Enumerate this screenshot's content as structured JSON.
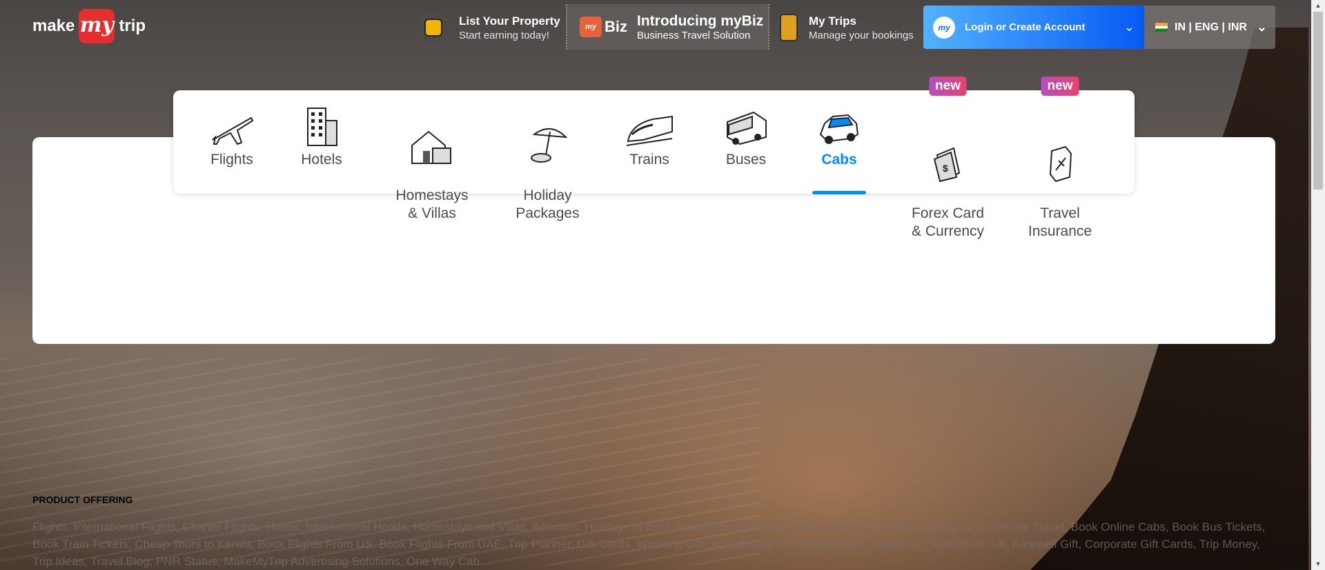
{
  "header": {
    "logo": {
      "make": "make",
      "my": "my",
      "trip": "trip"
    },
    "list_property": {
      "title": "List Your Property",
      "subtitle": "Start earning today!",
      "icon": "house-key-icon"
    },
    "mybiz": {
      "badge": "my",
      "word": "Biz",
      "title": "Introducing myBiz",
      "subtitle": "Business Travel Solution"
    },
    "my_trips": {
      "title": "My Trips",
      "subtitle": "Manage your bookings",
      "icon": "suitcase-icon"
    },
    "login": {
      "avatar": "my",
      "label": "Login or Create Account",
      "chevron": "⌄"
    },
    "locale": {
      "label": "IN | ENG | INR",
      "chevron": "⌄"
    }
  },
  "nav": {
    "items": [
      {
        "label": "Flights",
        "icon": "airplane-icon"
      },
      {
        "label": "Hotels",
        "icon": "hotel-icon"
      },
      {
        "label": "Homestays\n& Villas",
        "icon": "house-icon"
      },
      {
        "label": "Holiday\nPackages",
        "icon": "beach-umbrella-icon"
      },
      {
        "label": "Trains",
        "icon": "train-icon"
      },
      {
        "label": "Buses",
        "icon": "bus-icon"
      },
      {
        "label": "Cabs",
        "icon": "cab-icon",
        "active": true
      },
      {
        "label": "Forex Card\n& Currency",
        "icon": "forex-card-icon",
        "badge": "new"
      },
      {
        "label": "Travel\nInsurance",
        "icon": "insurance-shield-icon",
        "badge": "new"
      }
    ]
  },
  "footer": {
    "offering_title": "PRODUCT OFFERING",
    "offering_text": "Flights, International Flights, Charter Flights, Hotels, International Hotels, Homestays and Villas, Activities, Holidays In India, International Holidays, Book Hotels From UAE, myBiz for Corporate Travel, Book Online Cabs, Book Bus Tickets, Book Train Tickets, Cheap Tours to Kerala, Book Flights From US, Book Flights From UAE, Trip Planner, Gift Cards, Wedding Gift, Anniversary Gift, Birthday Gift, Diwali Gift, Valentines Gift, Farewell Gift, Corporate Gift Cards, Trip Money, Trip Ideas, Travel Blog, PNR Status, MakeMyTrip Advertising Solutions, One Way Cab"
  },
  "colors": {
    "accent": "#008cff",
    "brand_red": "#e62e2e",
    "login_gradient_start": "#53b2fe",
    "login_gradient_end": "#065af3"
  }
}
